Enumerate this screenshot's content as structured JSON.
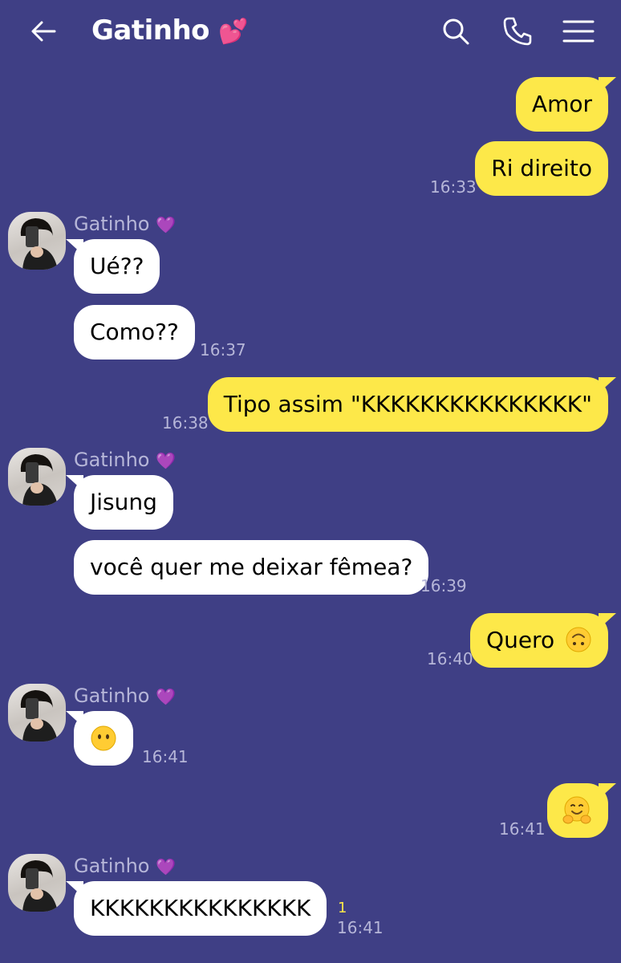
{
  "header": {
    "title": "Gatinho",
    "title_emoji": "💕"
  },
  "contact": {
    "name": "Gatinho",
    "emoji": "💜"
  },
  "messages": [
    {
      "text": "Amor"
    },
    {
      "text": "Ri direito",
      "time": "16:33"
    },
    {
      "text": "Ué??"
    },
    {
      "text": "Como??",
      "time": "16:37"
    },
    {
      "text": "Tipo assim \"KKKKKKKKKKKKKKK\"",
      "time": "16:38"
    },
    {
      "text": "Jisung"
    },
    {
      "text": "você quer me deixar fêmea?",
      "time": "16:39"
    },
    {
      "text": "Quero",
      "emoji": "upside-down-face",
      "time": "16:40"
    },
    {
      "emoji": "face-without-mouth",
      "time": "16:41"
    },
    {
      "emoji": "hugging-face",
      "time": "16:41"
    },
    {
      "text": "KKKKKKKKKKKKKKK",
      "time": "16:41",
      "unread": "1"
    }
  ],
  "colors": {
    "background": "#3f3f85",
    "outgoing_bubble": "#fde849",
    "incoming_bubble": "#ffffff",
    "timestamp": "#b6b6d8"
  },
  "icons": [
    "back-arrow-icon",
    "search-icon",
    "phone-icon",
    "menu-icon"
  ]
}
